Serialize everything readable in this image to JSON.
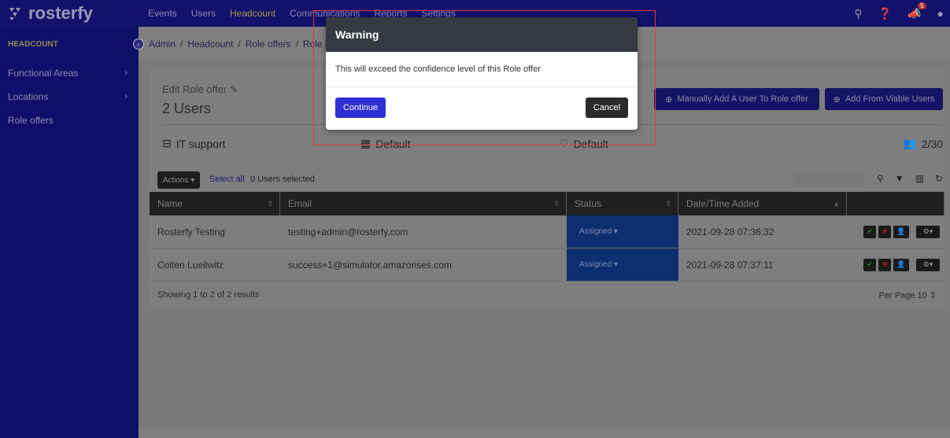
{
  "brand": {
    "name": "rosterfy"
  },
  "nav": {
    "items": [
      "Events",
      "Users",
      "Headcount",
      "Communications",
      "Reports",
      "Settings"
    ],
    "active": "Headcount"
  },
  "top_icons": {
    "search": "search-icon",
    "help": "help-icon",
    "notifications": "megaphone-icon",
    "notification_count": "5",
    "user": "user-icon"
  },
  "sidebar": {
    "heading": "HEADCOUNT",
    "items": [
      {
        "label": "Functional Areas",
        "chevron": "›"
      },
      {
        "label": "Locations",
        "chevron": "›"
      },
      {
        "label": "Role offers",
        "chevron": ""
      }
    ]
  },
  "breadcrumb": {
    "items": [
      "Admin",
      "Headcount",
      "Role offers",
      "Role o"
    ],
    "separator": "/"
  },
  "page": {
    "edit_label": "Edit Role offer",
    "users_count": "2 Users",
    "manual_add_label": "Manually Add A User To Role offer",
    "add_viable_label": "Add From Viable Users",
    "functional_area": "IT support",
    "location": "Default",
    "shift": "Default",
    "capacity": "2/30"
  },
  "toolbar": {
    "actions_label": "Actions ▾",
    "select_all_label": "Select all",
    "selected_text": "0 Users selected",
    "search_placeholder": "Search"
  },
  "table": {
    "columns": [
      "Name",
      "Email",
      "Status",
      "Date/Time Added"
    ],
    "rows": [
      {
        "name": "Rosterfy Testing",
        "email": "testing+admin@rosterfy.com",
        "status": "Assigned ▾",
        "added": "2021-09-28 07:36:32"
      },
      {
        "name": "Colten Lueilwitz",
        "email": "success+1@simulator.amazonses.com",
        "status": "Assigned ▾",
        "added": "2021-09-28 07:37:11"
      }
    ],
    "summary": "Showing 1 to 2 of 2 results",
    "per_page_label": "Per Page",
    "per_page_value": "10"
  },
  "modal": {
    "title": "Warning",
    "message": "This will exceed the confidence level of this Role offer",
    "continue_label": "Continue",
    "cancel_label": "Cancel"
  },
  "colors": {
    "nav_bg": "#12116b",
    "primary_button": "#2f2fd4",
    "modal_header": "#343a40",
    "highlight": "#e23b3b"
  }
}
